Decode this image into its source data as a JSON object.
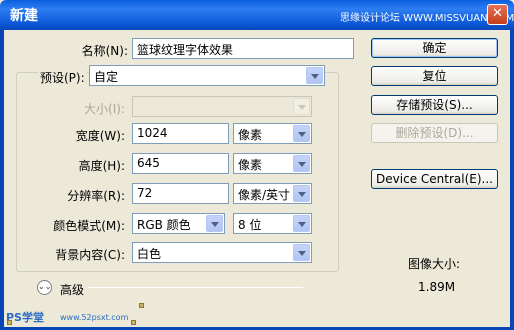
{
  "window": {
    "title": "新建",
    "watermark": "思缘设计论坛 WWW.MISSVUAN.COM",
    "close_glyph": "✕"
  },
  "form": {
    "name": {
      "label": "名称(N):",
      "value": "篮球纹理字体效果"
    },
    "preset": {
      "label": "预设(P):",
      "value": "自定"
    },
    "size": {
      "label": "大小(I):",
      "value": ""
    },
    "width": {
      "label": "宽度(W):",
      "value": "1024",
      "unit": "像素"
    },
    "height": {
      "label": "高度(H):",
      "value": "645",
      "unit": "像素"
    },
    "resolution": {
      "label": "分辨率(R):",
      "value": "72",
      "unit": "像素/英寸"
    },
    "color_mode": {
      "label": "颜色模式(M):",
      "value": "RGB 颜色",
      "depth": "8 位"
    },
    "background": {
      "label": "背景内容(C):",
      "value": "白色"
    },
    "advanced": {
      "label": "高级",
      "icon": "double-chevron-down-icon"
    }
  },
  "buttons": {
    "ok": "确定",
    "reset": "复位",
    "save_preset": "存储预设(S)...",
    "delete_preset": "删除预设(D)...",
    "device_central": "Device Central(E)..."
  },
  "image_size": {
    "label": "图像大小:",
    "value": "1.89M"
  },
  "footer": {
    "logo": "PS学堂",
    "site": "www.52psxt.com"
  }
}
